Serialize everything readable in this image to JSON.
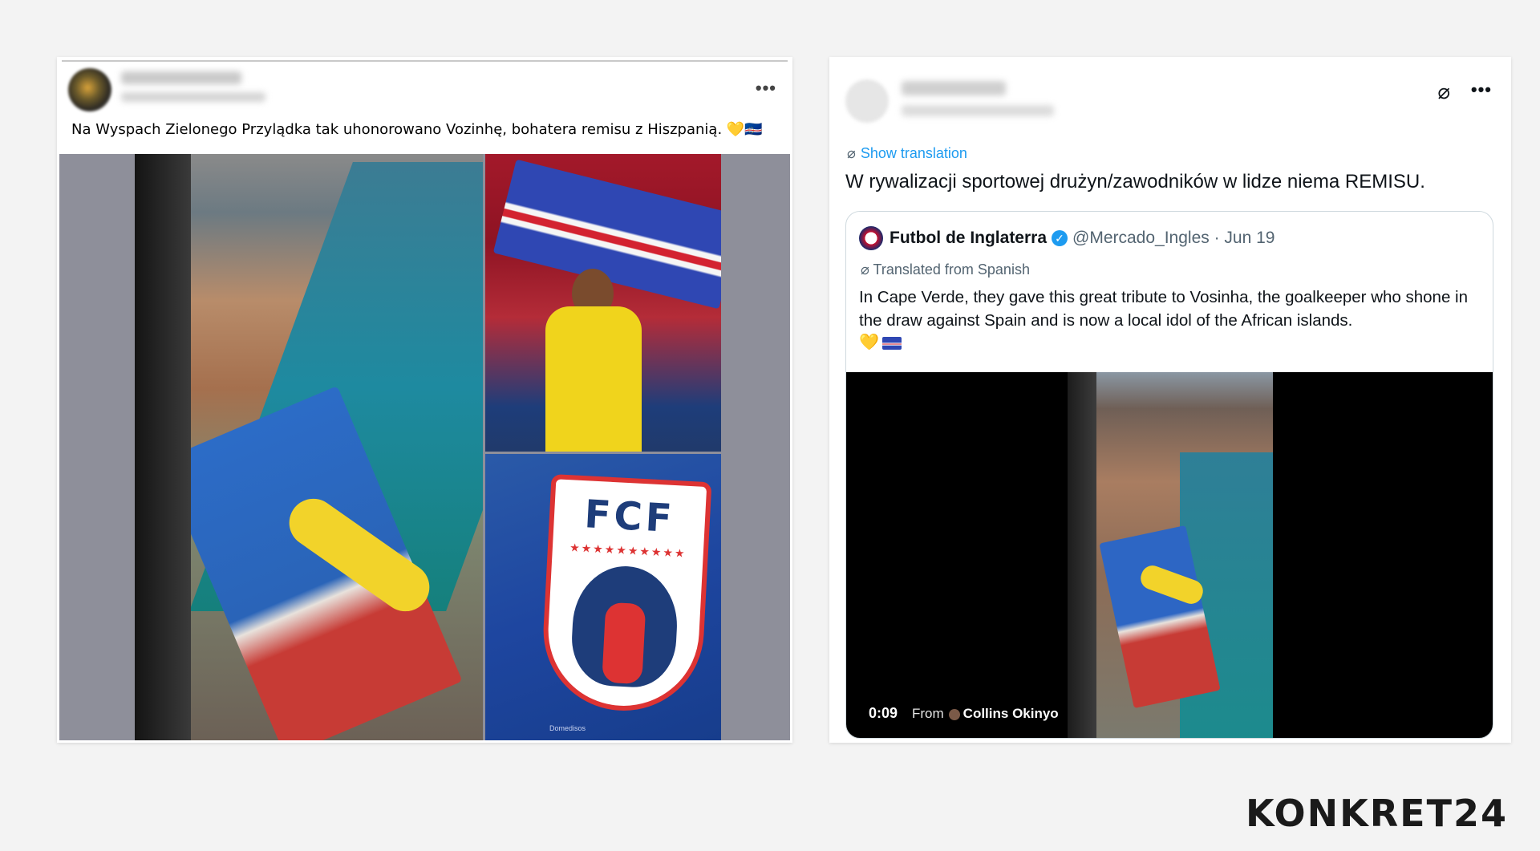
{
  "facebook_post": {
    "author_name": "",
    "post_date": "",
    "more_icon": "•••",
    "caption": "Na Wyspach Zielonego Przylądka tak uhonorowano Vozinhę, bohatera remisu z Hiszpanią. 💛🇨🇻",
    "crest_text": "FCF",
    "crest_stars": "★★★★★★★★★★",
    "media_credit": "Domedisos"
  },
  "twitter_post": {
    "author_name": "",
    "author_handle": "",
    "grok_icon": "⌀",
    "more_icon": "•••",
    "show_translation": "Show translation",
    "translate_icon": "⌀",
    "text": "W rywalizacji sportowej drużyn/zawodników w lidze niema REMISU.",
    "quoted": {
      "name": "Futbol de Inglaterra",
      "verified_icon": "✓",
      "handle_date": "@Mercado_Ingles · Jun 19",
      "translated_label": "Translated from Spanish",
      "text": "In Cape Verde, they gave this great tribute to Vosinha, the goalkeeper who shone in the draw against Spain and is now a local idol of the African islands.",
      "emoji_heart": "💛",
      "video": {
        "time": "0:09",
        "from_label": "From",
        "author": "Collins Okinyo"
      }
    }
  },
  "brand": "KONKRET24",
  "colors": {
    "twitter_blue": "#1d9bf0",
    "muted_text": "#536471"
  }
}
